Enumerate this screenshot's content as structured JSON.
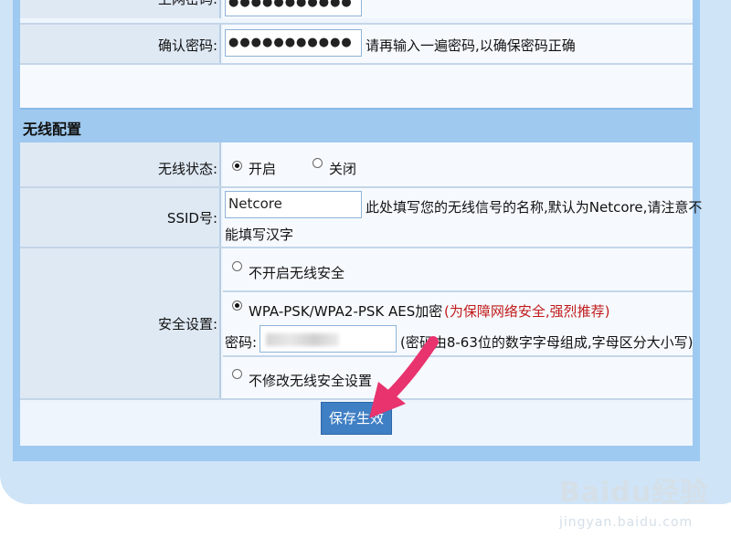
{
  "login": {
    "password_label": "上网密码:",
    "password_value": "●●●●●●●●●●●",
    "confirm_label": "确认密码:",
    "confirm_value": "●●●●●●●●●●●",
    "confirm_hint": "请再输入一遍密码,以确保密码正确"
  },
  "wireless": {
    "section_title": "无线配置",
    "status_label": "无线状态:",
    "status_options": [
      "开启",
      "关闭"
    ],
    "status_selected": "开启",
    "ssid_label": "SSID号:",
    "ssid_value": "Netcore",
    "ssid_hint_line1": "此处填写您的无线信号的名称,默认为Netcore,请注意不",
    "ssid_hint_line2": "能填写汉字",
    "security_label": "安全设置:",
    "security_options": [
      "不开启无线安全",
      "WPA-PSK/WPA2-PSK AES加密",
      "不修改无线安全设置"
    ],
    "security_selected": "WPA-PSK/WPA2-PSK AES加密",
    "security_recommend": "(为保障网络安全,强烈推荐)",
    "key_label": "密码:",
    "key_hint": "(密码由8-63位的数字字母组成,字母区分大小写)"
  },
  "save_label": "保存生效",
  "watermark": {
    "logo": "Baidu经验",
    "url": "jingyan.baidu.com"
  },
  "colors": {
    "accent": "#3f7fc4",
    "section_header": "#9fc9ef",
    "arrow": "#e8336e",
    "recommend_text": "#c11a1a"
  }
}
